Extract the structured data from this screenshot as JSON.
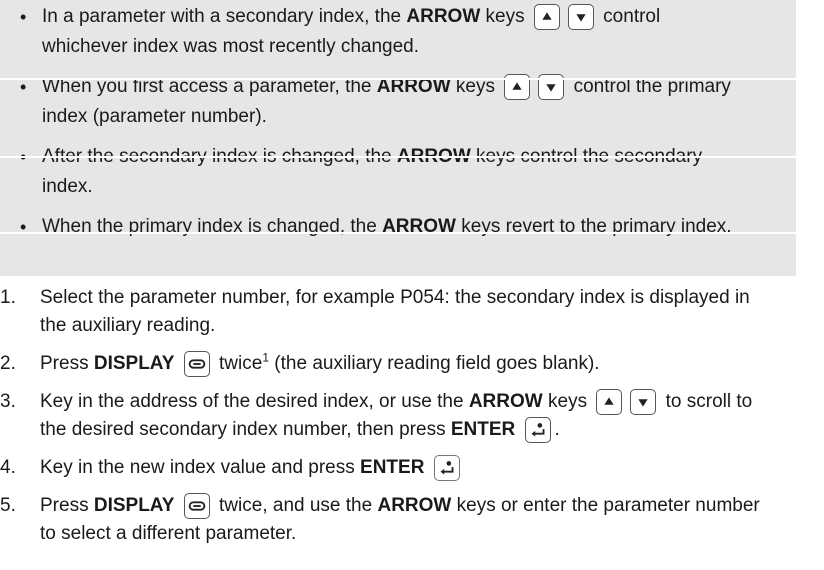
{
  "note": {
    "bullets": [
      {
        "before": "In a parameter with a secondary index, the ",
        "kw": "ARROW",
        "middle": " keys",
        "after": " control",
        "cont": "whichever index was most recently changed."
      },
      {
        "before": "When you first access a parameter, the ",
        "kw": "ARROW",
        "middle": " keys",
        "after": " control the primary",
        "cont": "index (parameter number)."
      },
      {
        "before": "After the secondary index is changed, the ",
        "kw": "ARROW",
        "after": " keys control the secondary",
        "cont": "index."
      },
      {
        "before": "When the primary index is changed, the ",
        "kw": "ARROW",
        "after": " keys revert to the primary index."
      }
    ]
  },
  "steps": [
    {
      "num": "1.",
      "text": "Select the parameter number, for example P054: the secondary index is displayed in",
      "cont": "the auxiliary reading."
    },
    {
      "num": "2.",
      "before": "Press ",
      "kw": "DISPLAY",
      "after1": " twice",
      "sup": "1",
      "after2": " (the auxiliary reading field goes blank)."
    },
    {
      "num": "3.",
      "before": "Key in the address of the desired index, or use the ",
      "kw": "ARROW",
      "middle": " keys",
      "after": " to scroll to",
      "cont": "the desired secondary index number, then press ",
      "kw2": "ENTER",
      "end": "."
    },
    {
      "num": "4.",
      "before": "Key in the new index value and press ",
      "kw": "ENTER"
    },
    {
      "num": "5.",
      "before": "Press ",
      "kw": "DISPLAY",
      "after": " twice, and use the ",
      "kw2": "ARROW",
      "after2": " keys or enter the parameter number",
      "cont": "to select a different parameter."
    }
  ],
  "icons": {
    "up": "arrow-up-key-icon",
    "down": "arrow-down-key-icon",
    "display": "display-key-icon",
    "enter": "enter-key-icon"
  }
}
